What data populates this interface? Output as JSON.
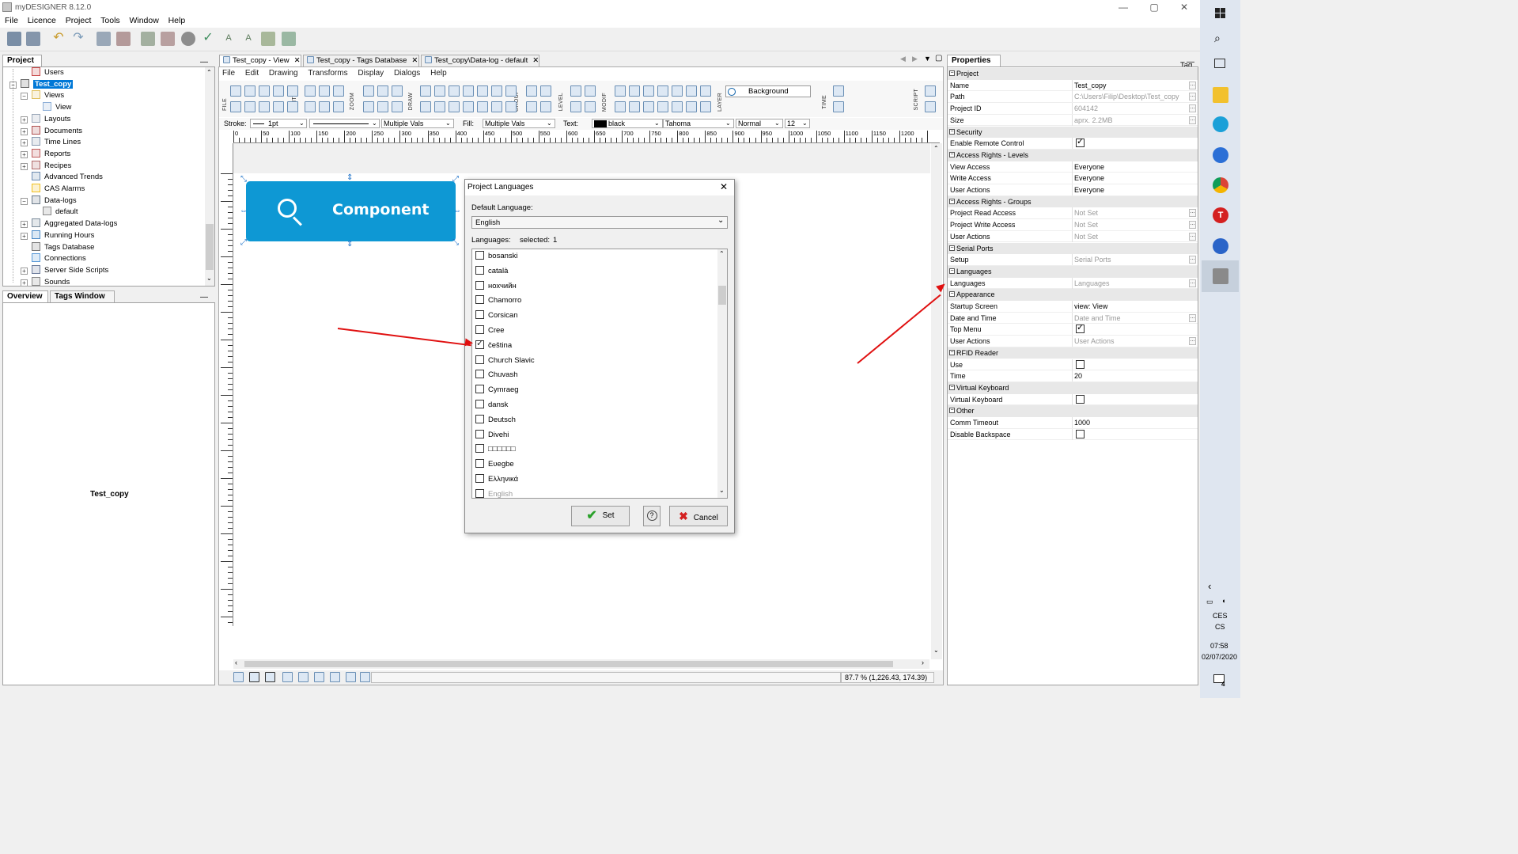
{
  "app": {
    "title": "myDESIGNER 8.12.0",
    "window_controls": {
      "minimize": "—",
      "maximize": "▢",
      "close": "✕"
    },
    "menu": [
      "File",
      "Licence",
      "Project",
      "Tools",
      "Window",
      "Help"
    ],
    "toolbar_right_label": "Tag"
  },
  "project_panel": {
    "tab": "Project",
    "items": [
      {
        "label": "Users",
        "level": 2
      },
      {
        "label": "Test_copy",
        "level": 1,
        "selected": true
      },
      {
        "label": "Views",
        "level": 2
      },
      {
        "label": "View",
        "level": 3
      },
      {
        "label": "Layouts",
        "level": 2
      },
      {
        "label": "Documents",
        "level": 2
      },
      {
        "label": "Time Lines",
        "level": 2
      },
      {
        "label": "Reports",
        "level": 2
      },
      {
        "label": "Recipes",
        "level": 2
      },
      {
        "label": "Advanced Trends",
        "level": 2
      },
      {
        "label": "CAS Alarms",
        "level": 2
      },
      {
        "label": "Data-logs",
        "level": 2
      },
      {
        "label": "default",
        "level": 3
      },
      {
        "label": "Aggregated Data-logs",
        "level": 2
      },
      {
        "label": "Running Hours",
        "level": 2
      },
      {
        "label": "Tags Database",
        "level": 2
      },
      {
        "label": "Connections",
        "level": 2
      },
      {
        "label": "Server Side Scripts",
        "level": 2
      },
      {
        "label": "Sounds",
        "level": 2
      }
    ]
  },
  "overview_panel": {
    "tabs": [
      "Overview",
      "Tags Window"
    ],
    "content": "Test_copy"
  },
  "editor": {
    "tabs": [
      {
        "label": "Test_copy - View",
        "active": true
      },
      {
        "label": "Test_copy - Tags Database",
        "active": false
      },
      {
        "label": "Test_copy\\Data-log - default",
        "active": false
      }
    ],
    "menu": [
      "File",
      "Edit",
      "Drawing",
      "Transforms",
      "Display",
      "Dialogs",
      "Help"
    ],
    "toolbar_groups": [
      "FILE",
      "EDIT",
      "ZOOM",
      "DRAW",
      "GROUP",
      "LEVEL",
      "MODIF",
      "LAYER",
      "TIME",
      "SCRIPT"
    ],
    "layer_value": "Background",
    "format_bar": {
      "stroke_label": "Stroke:",
      "stroke_value": "1pt",
      "stroke_style": "Multiple Vals",
      "fill_label": "Fill:",
      "fill_value": "Multiple Vals",
      "text_label": "Text:",
      "text_color": "black",
      "font": "Tahoma",
      "weight": "Normal",
      "size": "12"
    },
    "ruler_ticks": [
      "0",
      "50",
      "100",
      "150",
      "200",
      "250",
      "300",
      "350",
      "400",
      "450",
      "500",
      "550",
      "600",
      "650",
      "700",
      "750",
      "800",
      "850",
      "900",
      "950",
      "1000",
      "1050",
      "1100",
      "1150",
      "1200"
    ],
    "component": {
      "label": "Component",
      "color": "#0e98d4"
    },
    "status": "87.7 % (1,226.43, 174.39)"
  },
  "dialog": {
    "title": "Project Languages",
    "close": "✕",
    "default_language_label": "Default Language:",
    "default_language": "English",
    "languages_label": "Languages:",
    "selected_label": "selected:",
    "selected_count": "1",
    "languages": [
      {
        "name": "bosanski",
        "checked": false
      },
      {
        "name": "català",
        "checked": false
      },
      {
        "name": "нохчийн",
        "checked": false
      },
      {
        "name": "Chamorro",
        "checked": false
      },
      {
        "name": "Corsican",
        "checked": false
      },
      {
        "name": "Cree",
        "checked": false
      },
      {
        "name": "čeština",
        "checked": true
      },
      {
        "name": "Church Slavic",
        "checked": false
      },
      {
        "name": "Chuvash",
        "checked": false
      },
      {
        "name": "Cymraeg",
        "checked": false
      },
      {
        "name": "dansk",
        "checked": false
      },
      {
        "name": "Deutsch",
        "checked": false
      },
      {
        "name": "Divehi",
        "checked": false
      },
      {
        "name": "□□□□□□",
        "checked": false
      },
      {
        "name": "Eʋegbe",
        "checked": false
      },
      {
        "name": "Ελληνικά",
        "checked": false
      },
      {
        "name": "English",
        "checked": false
      }
    ],
    "set_button": "Set",
    "help_button": "?",
    "cancel_button": "Cancel"
  },
  "properties": {
    "tab": "Properties",
    "rows": [
      {
        "type": "group",
        "name": "Project"
      },
      {
        "name": "Name",
        "value": "Test_copy",
        "ellipsis": true
      },
      {
        "name": "Path",
        "value": "C:\\Users\\Filip\\Desktop\\Test_copy",
        "gray": true,
        "ellipsis": true
      },
      {
        "name": "Project ID",
        "value": "604142",
        "gray": true,
        "ellipsis": true
      },
      {
        "name": "Size",
        "value": "aprx. 2.2MB",
        "gray": true,
        "ellipsis": true
      },
      {
        "type": "group",
        "name": "Security"
      },
      {
        "name": "Enable Remote Control",
        "checkbox": true,
        "checked": true
      },
      {
        "type": "group",
        "name": "Access Rights - Levels"
      },
      {
        "name": "View Access",
        "value": "Everyone"
      },
      {
        "name": "Write Access",
        "value": "Everyone"
      },
      {
        "name": "User Actions",
        "value": "Everyone"
      },
      {
        "type": "group",
        "name": "Access Rights - Groups"
      },
      {
        "name": "Project Read Access",
        "value": "Not Set",
        "gray": true,
        "ellipsis": true
      },
      {
        "name": "Project Write Access",
        "value": "Not Set",
        "gray": true,
        "ellipsis": true
      },
      {
        "name": "User Actions",
        "value": "Not Set",
        "gray": true,
        "ellipsis": true
      },
      {
        "type": "group",
        "name": "Serial Ports"
      },
      {
        "name": "Setup",
        "value": "Serial Ports",
        "gray": true,
        "ellipsis": true
      },
      {
        "type": "group",
        "name": "Languages"
      },
      {
        "name": "Languages",
        "value": "Languages",
        "gray": true,
        "ellipsis": true
      },
      {
        "type": "group",
        "name": "Appearance"
      },
      {
        "name": "Startup Screen",
        "value": "view: View"
      },
      {
        "name": "Date and Time",
        "value": "Date and Time",
        "gray": true,
        "ellipsis": true
      },
      {
        "name": "Top Menu",
        "checkbox": true,
        "checked": true
      },
      {
        "name": "User Actions",
        "value": "User Actions",
        "gray": true,
        "ellipsis": true
      },
      {
        "type": "group",
        "name": "RFID Reader"
      },
      {
        "name": "Use",
        "checkbox": true,
        "checked": false
      },
      {
        "name": "Time",
        "value": "20"
      },
      {
        "type": "group",
        "name": "Virtual Keyboard"
      },
      {
        "name": "Virtual Keyboard",
        "checkbox": true,
        "checked": false
      },
      {
        "type": "group",
        "name": "Other"
      },
      {
        "name": "Comm Timeout",
        "value": "1000"
      },
      {
        "name": "Disable Backspace",
        "checkbox": true,
        "checked": false
      }
    ]
  },
  "taskbar": {
    "icons": [
      "windows-start-icon",
      "search-icon",
      "task-view-icon",
      "file-explorer-icon",
      "edge-icon",
      "app-icon",
      "chrome-icon",
      "app-red-icon",
      "app-blue-icon",
      "mydesigner-icon"
    ],
    "lang_top": "CES",
    "lang_bottom": "CS",
    "time": "07:58",
    "date": "02/07/2020",
    "notifications": "4"
  },
  "colors": {
    "accent": "#0e98d4",
    "selection": "#0078d7",
    "annotation_arrow": "#e01010",
    "check": "#2aa12a",
    "cancel": "#d42020"
  }
}
